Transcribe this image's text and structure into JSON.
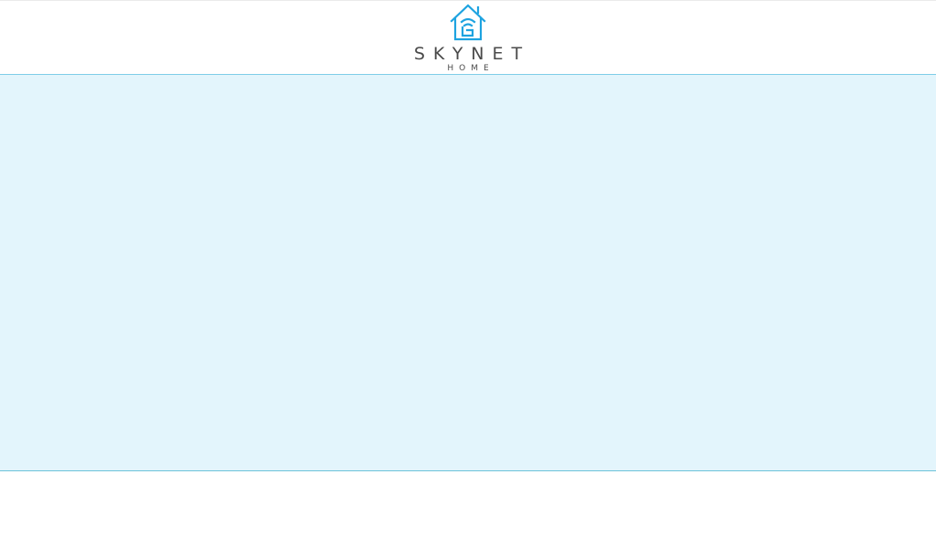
{
  "header": {
    "logo": {
      "wordmark": "SKYNET",
      "subword": "HOME",
      "icon": "house-wifi-icon"
    }
  },
  "colors": {
    "brand_blue": "#1ea3e0",
    "text_gray": "#4a4a4a",
    "panel_background": "#e3f5fc",
    "panel_border": "#6cc3d9"
  }
}
